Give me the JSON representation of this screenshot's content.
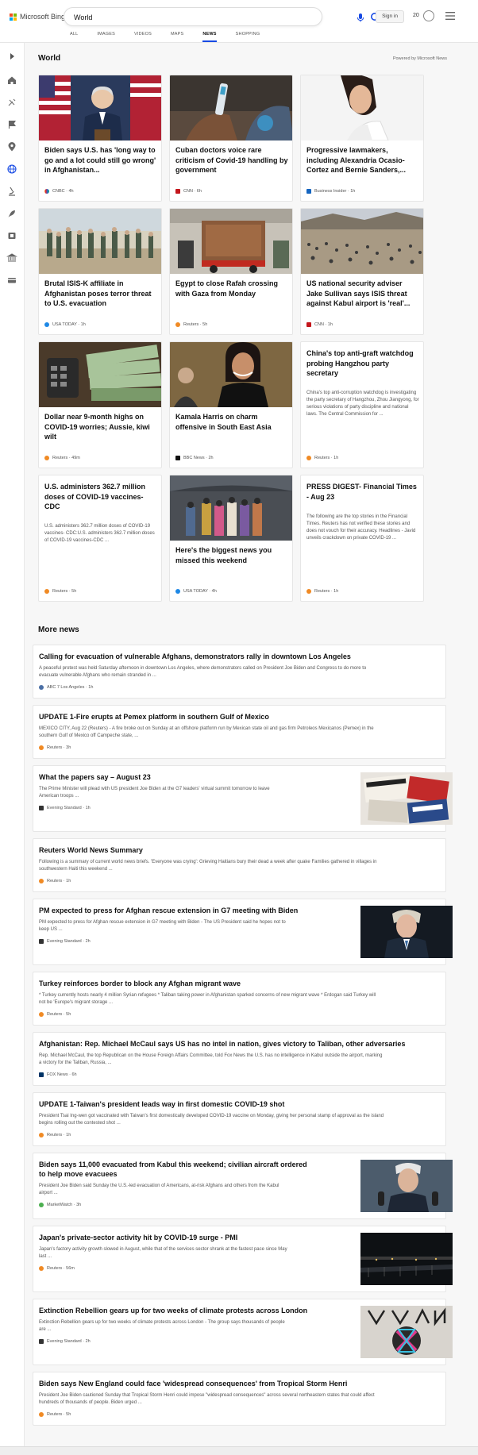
{
  "header": {
    "logo_text": "Microsoft Bing",
    "search_value": "World",
    "signin": "Sign in",
    "points": "20"
  },
  "tabs": [
    "ALL",
    "IMAGES",
    "VIDEOS",
    "MAPS",
    "NEWS",
    "SHOPPING"
  ],
  "active_tab": "NEWS",
  "section": {
    "title": "World",
    "powered": "Powered by Microsoft News"
  },
  "cards": [
    {
      "title": "Biden says U.S. has 'long way to go and a lot could still go wrong' in Afghanistan...",
      "source": "CNBC · 4h"
    },
    {
      "title": "Cuban doctors voice rare criticism of Covid-19 handling by government",
      "source": "CNN · 6h"
    },
    {
      "title": "Progressive lawmakers, including Alexandria Ocasio-Cortez and Bernie Sanders,...",
      "source": "Business Insider · 1h"
    },
    {
      "title": "Brutal ISIS-K affiliate in Afghanistan poses terror threat to U.S. evacuation",
      "source": "USA TODAY · 1h"
    },
    {
      "title": "Egypt to close Rafah crossing with Gaza from Monday",
      "source": "Reuters · 5h"
    },
    {
      "title": "US national security adviser Jake Sullivan says ISIS threat against Kabul airport is 'real'...",
      "source": "CNN · 1h"
    },
    {
      "title": "Dollar near 9-month highs on COVID-19 worries; Aussie, kiwi wilt",
      "source": "Reuters · 49m"
    },
    {
      "title": "Kamala Harris on charm offensive in South East Asia",
      "source": "BBC News · 2h"
    },
    {
      "title": "China's top anti-graft watchdog probing Hangzhou party secretary",
      "snippet": "China's top anti-corruption watchdog is investigating the party secretary of Hangzhou, Zhou Jiangyong, for serious violations of party discipline and national laws. The Central Commission for ...",
      "source": "Reuters · 1h"
    },
    {
      "title": "U.S. administers 362.7 million doses of COVID-19 vaccines-CDC",
      "snippet": "U.S. administers 362.7 million doses of COVID-19 vaccines- CDC:U.S. administers 362.7 million doses of COVID-19 vaccines-CDC ...",
      "source": "Reuters · 5h"
    },
    {
      "title": "Here's the biggest news you missed this weekend",
      "source": "USA TODAY · 4h"
    },
    {
      "title": "PRESS DIGEST- Financial Times - Aug 23",
      "snippet": "The following are the top stories in the Financial Times. Reuters has not verified these stories and does not vouch for their accuracy. Headlines - Javid unveils crackdown on private COVID-19 ...",
      "source": "Reuters · 1h"
    }
  ],
  "more_news_title": "More news",
  "more_news": [
    {
      "title": "Calling for evacuation of vulnerable Afghans, demonstrators rally in downtown Los Angeles",
      "snippet1": "A peaceful protest was held Saturday afternoon in downtown Los Angeles, where demonstrators called on President Joe Biden and Congress to do more to",
      "snippet2": "evacuate vulnerable Afghans who remain stranded in ...",
      "source": "ABC 7 Los Angeles · 1h"
    },
    {
      "title": "UPDATE 1-Fire erupts at Pemex platform in southern Gulf of Mexico",
      "snippet1": "MEXICO CITY, Aug 22 (Reuters) - A fire broke out on Sunday at an offshore platform run by Mexican state oil and gas firm Petroleos Mexicanos (Pemex) in the",
      "snippet2": "southern Gulf of Mexico off Campeche state, ...",
      "source": "Reuters · 3h"
    },
    {
      "title": "What the papers say – August 23",
      "snippet1": "The Prime Minister will plead with US president Joe Biden at the G7 leaders' virtual summit tomorrow to leave",
      "snippet2": "American troops ...",
      "source": "Evening Standard · 1h"
    },
    {
      "title": "Reuters World News Summary",
      "snippet1": "Following is a summary of current world news briefs. 'Everyone was crying': Grieving Haitians bury their dead a week after quake Families gathered in villages in",
      "snippet2": "southwestern Haiti this weekend ...",
      "source": "Reuters · 1h"
    },
    {
      "title": "PM expected to press for Afghan rescue extension in G7 meeting with Biden",
      "snippet1": "PM expected to press for Afghan rescue extension in G7 meeting with Biden - The US President said he hopes not to",
      "snippet2": "keep US ...",
      "source": "Evening Standard · 2h"
    },
    {
      "title": "Turkey reinforces border to block any Afghan migrant wave",
      "snippet1": "* Turkey currently hosts nearly 4 million Syrian refugees * Taliban taking power in Afghanistan sparked concerns of new migrant wave * Erdogan said Turkey will",
      "snippet2": "not be 'Europe's migrant storage ...",
      "source": "Reuters · 5h"
    },
    {
      "title": "Afghanistan: Rep. Michael McCaul says US has no intel in nation, gives victory to Taliban, other adversaries",
      "snippet1": "Rep. Michael McCaul, the top Republican on the House Foreign Affairs Committee, told Fox News the U.S. has no intelligence in Kabul outside the airport, marking",
      "snippet2": "a victory for the Taliban, Russia, ...",
      "source": "FOX News · 6h"
    },
    {
      "title": "UPDATE 1-Taiwan's president leads way in first domestic COVID-19 shot",
      "snippet1": "President Tsai Ing-wen got vaccinated with Taiwan's first domestically developed COVID-19 vaccine on Monday, giving her personal stamp of approval as the island",
      "snippet2": "begins rolling out the contested shot ...",
      "source": "Reuters · 1h"
    },
    {
      "title": "Biden says 11,000 evacuated from Kabul this weekend; civilian aircraft ordered",
      "title2": "to help move evacuees",
      "snippet1": "President Joe Biden said Sunday the U.S.-led evacuation of Americans, at-risk Afghans and others from the Kabul",
      "snippet2": "airport ...",
      "source": "MarketWatch · 3h"
    },
    {
      "title": "Japan's private-sector activity hit by COVID-19 surge - PMI",
      "snippet1": "Japan's factory activity growth slowed in August, while that of the services sector shrank at the fastest pace since May",
      "snippet2": "last ...",
      "source": "Reuters · 56m"
    },
    {
      "title": "Extinction Rebellion gears up for two weeks of climate protests across London",
      "snippet1": "Extinction Rebellion gears up for two weeks of climate protests across London - The group says thousands of people",
      "snippet2": "are ...",
      "source": "Evening Standard · 2h"
    },
    {
      "title": "Biden says New England could face 'widespread consequences' from Tropical Storm Henri",
      "snippet1": "President Joe Biden cautioned Sunday that Tropical Storm Henri could impose \"widespread consequences\" across several northeastern states that could affect",
      "snippet2": "hundreds of thousands of people. Biden urged ...",
      "source": "Reuters · 5h"
    }
  ],
  "colors": {
    "accent": "#174ae4",
    "reuters": "#f08a24",
    "cnn": "#c4161c",
    "usatoday": "#1e88e5"
  }
}
